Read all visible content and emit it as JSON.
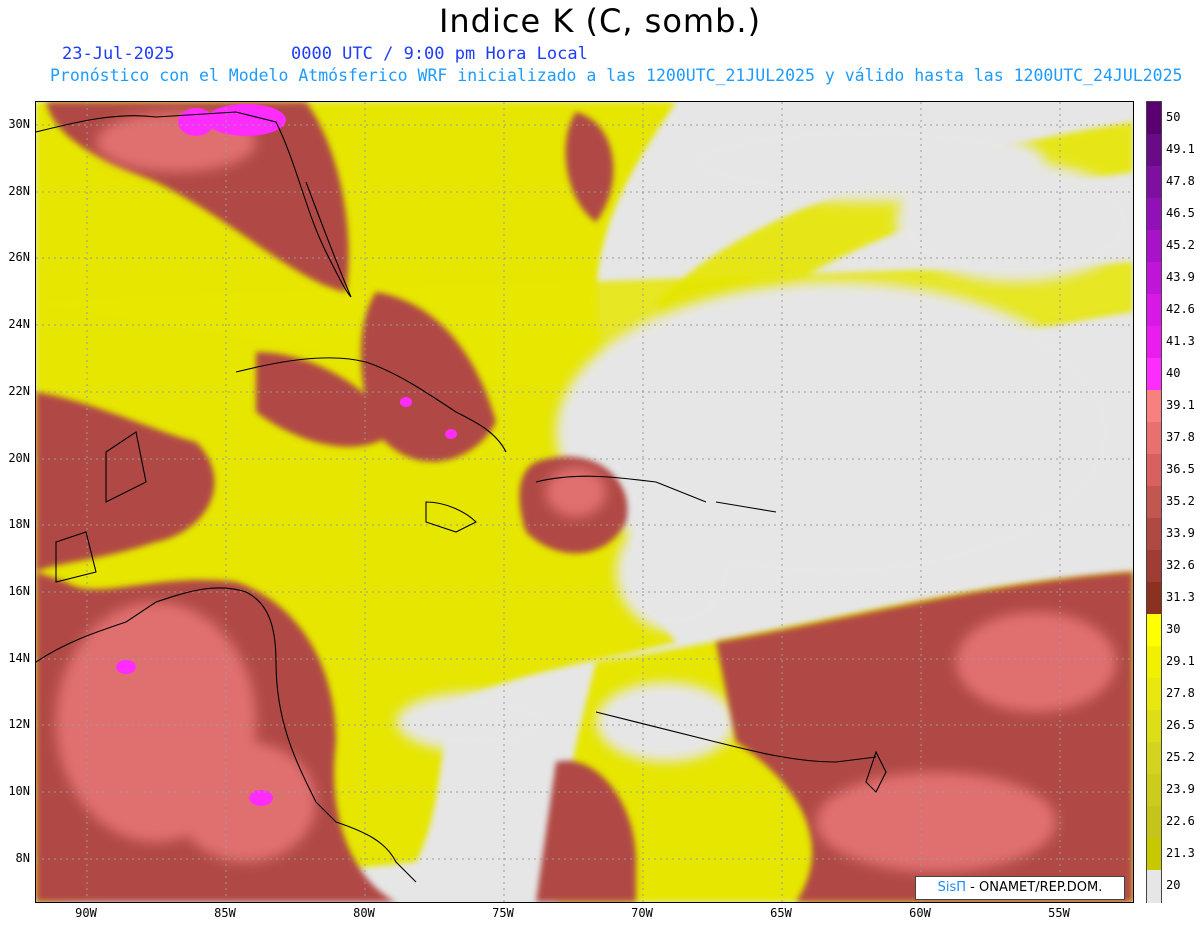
{
  "header": {
    "title": "Indice K (C, somb.)",
    "date": "23-Jul-2025",
    "time": "0000 UTC / 9:00 pm Hora Local",
    "subtitle": "Pronóstico con el Modelo Atmósferico WRF inicializado a las 1200UTC_21JUL2025 y válido hasta las  1200UTC_24JUL2025"
  },
  "axes": {
    "lat_labels": [
      "30N",
      "28N",
      "26N",
      "24N",
      "22N",
      "20N",
      "18N",
      "16N",
      "14N",
      "12N",
      "10N",
      "8N"
    ],
    "lon_labels": [
      "90W",
      "85W",
      "80W",
      "75W",
      "70W",
      "65W",
      "60W",
      "55W"
    ]
  },
  "colorbar": {
    "labels": [
      "50",
      "49.1",
      "47.8",
      "46.5",
      "45.2",
      "43.9",
      "42.6",
      "41.3",
      "40",
      "39.1",
      "37.8",
      "36.5",
      "35.2",
      "33.9",
      "32.6",
      "31.3",
      "30",
      "29.1",
      "27.8",
      "26.5",
      "25.2",
      "23.9",
      "22.6",
      "21.3",
      "20"
    ],
    "colors": [
      "#5a0070",
      "#6a0a88",
      "#7d10a0",
      "#9210b8",
      "#a812c8",
      "#c015d8",
      "#d818e6",
      "#ea1cf0",
      "#ff2cff",
      "#f88080",
      "#ea7070",
      "#d86060",
      "#c45650",
      "#b04844",
      "#a03c36",
      "#8c3020",
      "#ffff00",
      "#f0f000",
      "#e8e810",
      "#dede18",
      "#d4d420",
      "#cccc1c",
      "#c4c41a",
      "#c8c800",
      "#e6e6e6"
    ]
  },
  "credit": {
    "sis": "SisΠ",
    "org": " - ONAMET/REP.DOM."
  }
}
